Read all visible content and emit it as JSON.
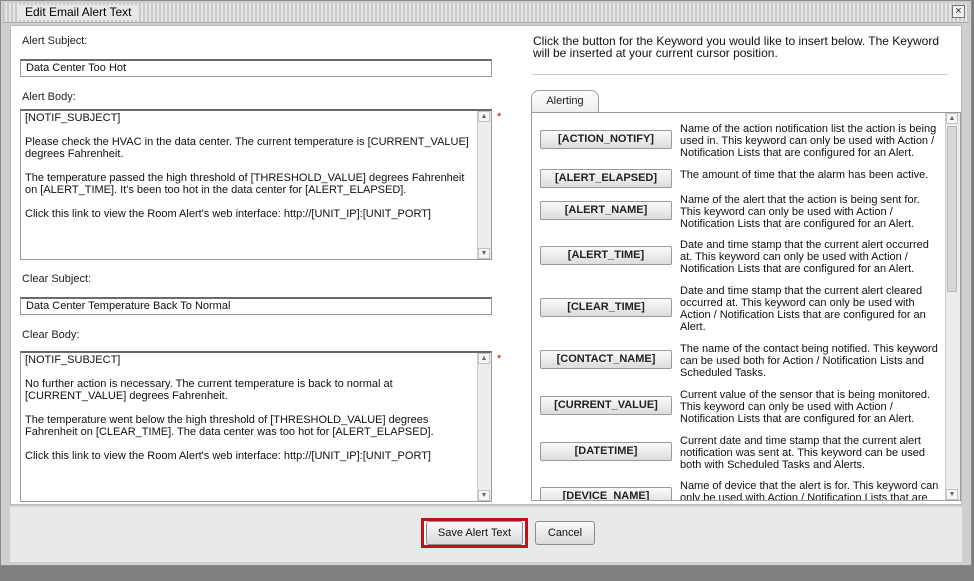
{
  "dialog": {
    "title": "Edit Email Alert Text",
    "close_glyph": "×"
  },
  "form": {
    "alert_subject_label": "Alert Subject:",
    "alert_subject_value": "Data Center Too Hot",
    "alert_body_label": "Alert Body:",
    "alert_body_value": "[NOTIF_SUBJECT]\n\nPlease check the HVAC in the data center. The current temperature is [CURRENT_VALUE] degrees Fahrenheit.\n\nThe temperature passed the high threshold of [THRESHOLD_VALUE] degrees Fahrenheit on [ALERT_TIME]. It's been too hot in the data center for [ALERT_ELAPSED].\n\nClick this link to view the Room Alert's web interface: http://[UNIT_IP]:[UNIT_PORT]",
    "clear_subject_label": "Clear Subject:",
    "clear_subject_value": "Data Center Temperature Back To Normal",
    "clear_body_label": "Clear Body:",
    "clear_body_value": "[NOTIF_SUBJECT]\n\nNo further action is necessary. The current temperature is back to normal at [CURRENT_VALUE] degrees Fahrenheit.\n\nThe temperature went below the high threshold of [THRESHOLD_VALUE] degrees Fahrenheit on [CLEAR_TIME]. The data center was too hot for [ALERT_ELAPSED].\n\nClick this link to view the Room Alert's web interface: http://[UNIT_IP]:[UNIT_PORT]",
    "required_marker": "*"
  },
  "keywords_panel": {
    "instruction": "Click the button for the Keyword you would like to insert below. The Keyword will be inserted at your current cursor position.",
    "tab_label": "Alerting",
    "items": [
      {
        "keyword": "[ACTION_NOTIFY]",
        "description": "Name of the action notification list the action is being used in. This keyword can only be used with Action / Notification Lists that are configured for an Alert."
      },
      {
        "keyword": "[ALERT_ELAPSED]",
        "description": "The amount of time that the alarm has been active."
      },
      {
        "keyword": "[ALERT_NAME]",
        "description": "Name of the alert that the action is being sent for. This keyword can only be used with Action / Notification Lists that are configured for an Alert."
      },
      {
        "keyword": "[ALERT_TIME]",
        "description": "Date and time stamp that the current alert occurred at. This keyword can only be used with Action / Notification Lists that are configured for an Alert."
      },
      {
        "keyword": "[CLEAR_TIME]",
        "description": "Date and time stamp that the current alert cleared occurred at. This keyword can only be used with Action / Notification Lists that are configured for an Alert."
      },
      {
        "keyword": "[CONTACT_NAME]",
        "description": "The name of the contact being notified. This keyword can be used both for Action / Notification Lists and Scheduled Tasks."
      },
      {
        "keyword": "[CURRENT_VALUE]",
        "description": "Current value of the sensor that is being monitored. This keyword can only be used with Action / Notification Lists that are configured for an Alert."
      },
      {
        "keyword": "[DATETIME]",
        "description": "Current date and time stamp that the current alert notification was sent at. This keyword can be used both with Scheduled Tasks and Alerts."
      },
      {
        "keyword": "[DEVICE_NAME]",
        "description": "Name of device that the alert is for. This keyword can only be used with Action / Notification Lists that are configured for an Alert."
      }
    ]
  },
  "buttons": {
    "save": "Save Alert Text",
    "cancel": "Cancel"
  },
  "scrollbar": {
    "up_glyph": "▲",
    "down_glyph": "▼"
  },
  "colors": {
    "highlight": "#c0101a",
    "required": "#cc0000"
  }
}
